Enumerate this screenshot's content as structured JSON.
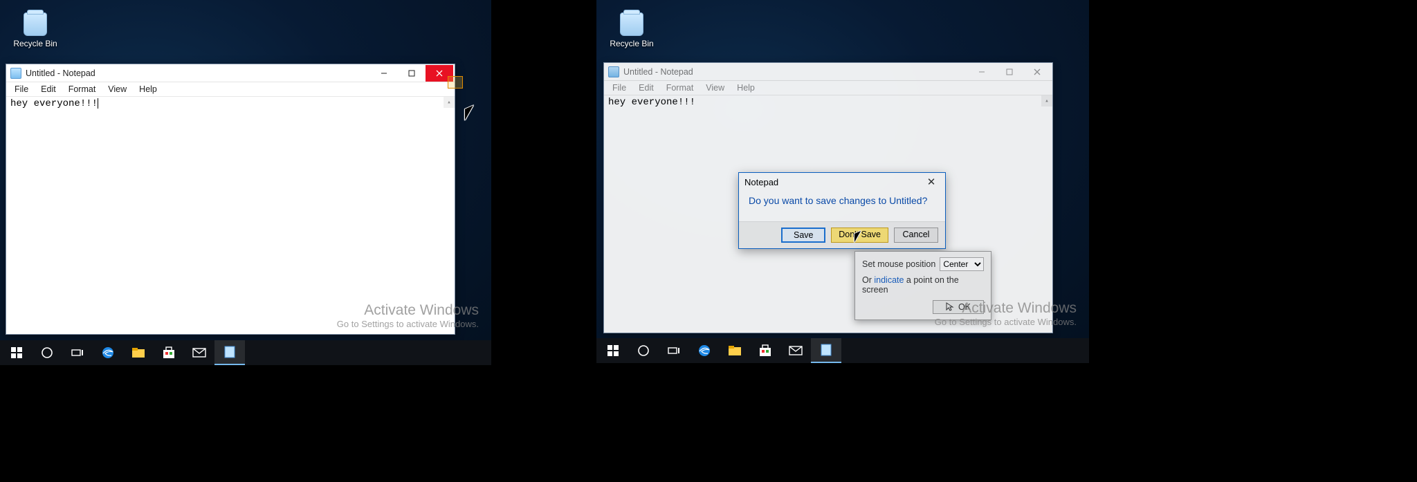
{
  "recycle_label": "Recycle Bin",
  "notepad": {
    "title": "Untitled - Notepad",
    "menus": [
      "File",
      "Edit",
      "Format",
      "View",
      "Help"
    ],
    "content": "hey everyone!!!"
  },
  "watermark": {
    "title": "Activate Windows",
    "sub": "Go to Settings to activate Windows."
  },
  "dialog": {
    "title": "Notepad",
    "message": "Do you want to save changes to Untitled?",
    "save": "Save",
    "dont": "Don't Save",
    "cancel": "Cancel"
  },
  "popover": {
    "label": "Set mouse position",
    "selected": "Center",
    "or": "Or ",
    "indicate": "indicate",
    "rest": " a point on the screen",
    "ok": "OK"
  }
}
